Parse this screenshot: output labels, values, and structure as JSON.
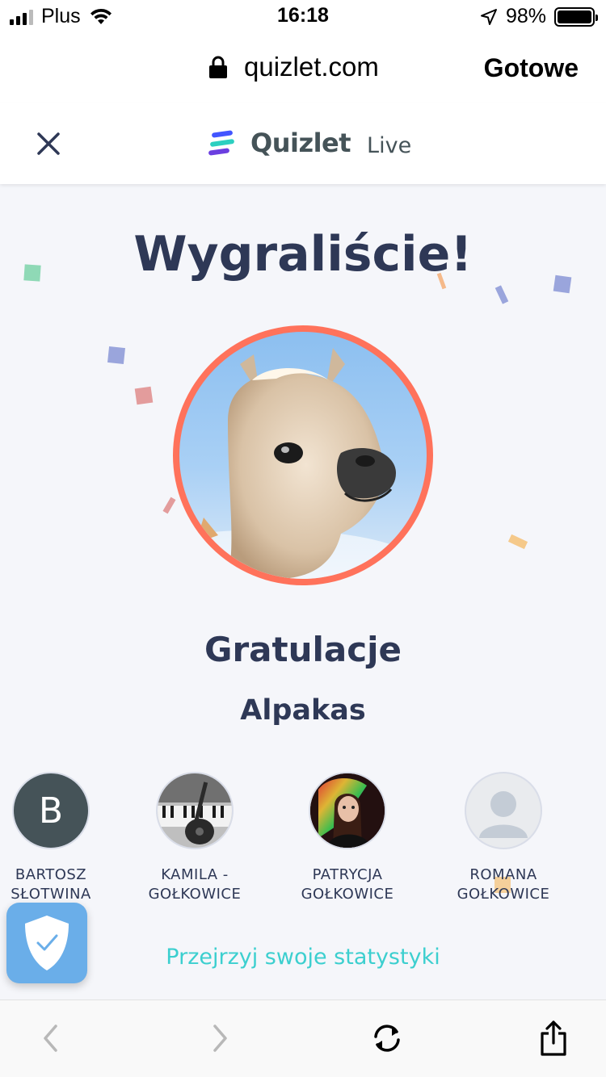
{
  "status_bar": {
    "carrier": "Plus",
    "time": "16:18",
    "battery_percent": "98%"
  },
  "browser": {
    "url": "quizlet.com",
    "done_label": "Gotowe"
  },
  "app_header": {
    "brand_name": "Quizlet",
    "brand_suffix": "Live"
  },
  "main": {
    "title": "Wygraliście!",
    "congrats": "Gratulacje",
    "team_name": "Alpakas",
    "stats_link": "Przejrzyj swoje statystyki"
  },
  "members": [
    {
      "first": "BARTOSZ",
      "last": "SŁOTWINA",
      "initial": "B"
    },
    {
      "first": "KAMILA -",
      "last": "GOŁKOWICE"
    },
    {
      "first": "PATRYCJA",
      "last": "GOŁKOWICE"
    },
    {
      "first": "ROMANA",
      "last": "GOŁKOWICE"
    }
  ],
  "colors": {
    "accent_ring": "#ff725b",
    "title_text": "#2e3856",
    "link": "#3ccfcf",
    "background": "#f5f6fa"
  }
}
